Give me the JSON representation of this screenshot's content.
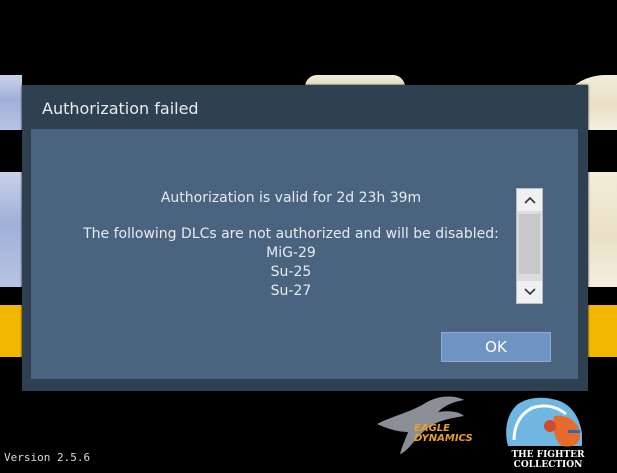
{
  "dialog": {
    "title": "Authorization failed",
    "message_line1": "Authorization is valid for 2d 23h 39m",
    "message_line2": "The following DLCs are not authorized and will be disabled:",
    "dlcs": [
      "MiG-29",
      "Su-25",
      "Su-27"
    ],
    "ok_label": "OK"
  },
  "footer": {
    "version": "Version 2.5.6",
    "eagle_logo_text": "EAGLE DYNAMICS",
    "fighter_logo_text": "THE FIGHTER COLLECTION"
  },
  "icons": {
    "scroll_up": "chevron-up-icon",
    "scroll_down": "chevron-down-icon"
  },
  "colors": {
    "dialog_frame": "#2f4050",
    "dialog_body": "#4a6480",
    "ok_button": "#6f94c4",
    "accent_yellow": "#f2b800"
  }
}
